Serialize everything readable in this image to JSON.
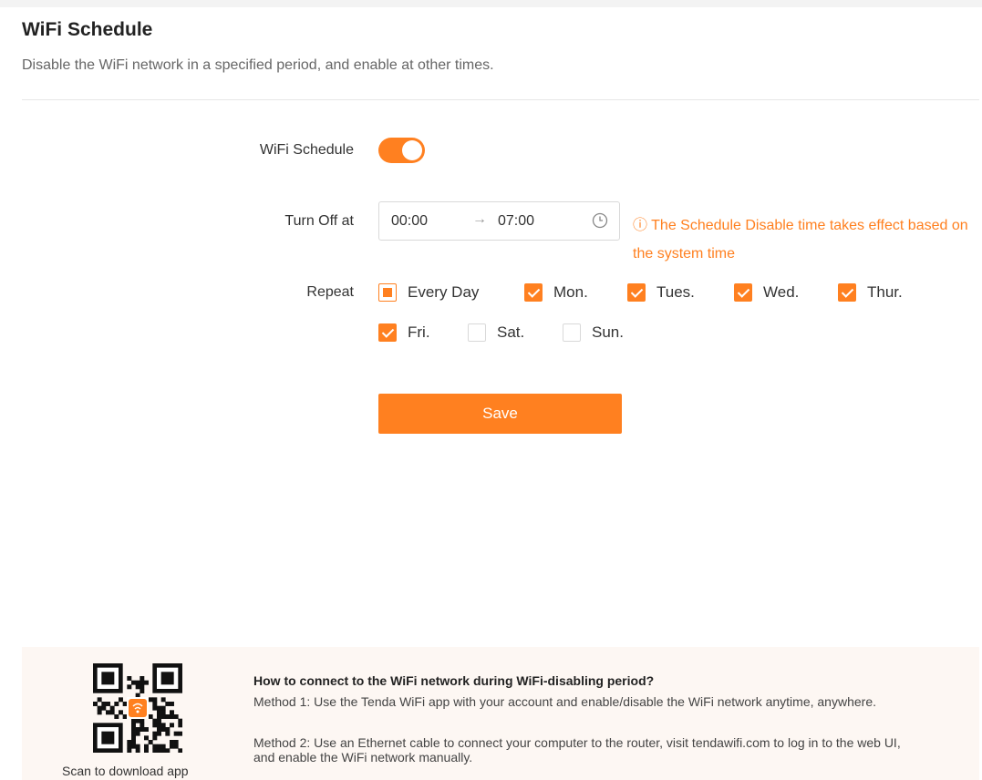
{
  "header": {
    "title": "WiFi Schedule",
    "description": "Disable the WiFi network in a specified period, and enable at other times."
  },
  "form": {
    "schedule_label": "WiFi Schedule",
    "schedule_enabled": true,
    "turn_off_label": "Turn Off at",
    "start_time": "00:00",
    "end_time": "07:00",
    "arrow": "→",
    "warning": "ⓘ The Schedule Disable time takes effect based on the system time",
    "repeat_label": "Repeat",
    "days": [
      {
        "label": "Every Day",
        "state": "partial"
      },
      {
        "label": "Mon.",
        "state": "checked"
      },
      {
        "label": "Tues.",
        "state": "checked"
      },
      {
        "label": "Wed.",
        "state": "checked"
      },
      {
        "label": "Thur.",
        "state": "checked"
      },
      {
        "label": "Fri.",
        "state": "checked"
      },
      {
        "label": "Sat.",
        "state": "unchecked"
      },
      {
        "label": "Sun.",
        "state": "unchecked"
      }
    ],
    "save_label": "Save"
  },
  "footer": {
    "qr_caption": "Scan to download app",
    "help_title": "How to connect to the WiFi network during WiFi-disabling period?",
    "method1": "Method 1: Use the Tenda WiFi app with your account and enable/disable the WiFi network anytime, anywhere.",
    "method2": "Method 2: Use an Ethernet cable to connect your computer to the router, visit tendawifi.com to log in to the web UI, and enable the WiFi network manually."
  },
  "colors": {
    "accent": "#ff8020",
    "footer_bg": "#fdf7f3"
  },
  "icons": {
    "clock": "clock-icon",
    "qr": "qr-code-icon",
    "wifi": "wifi-icon"
  }
}
